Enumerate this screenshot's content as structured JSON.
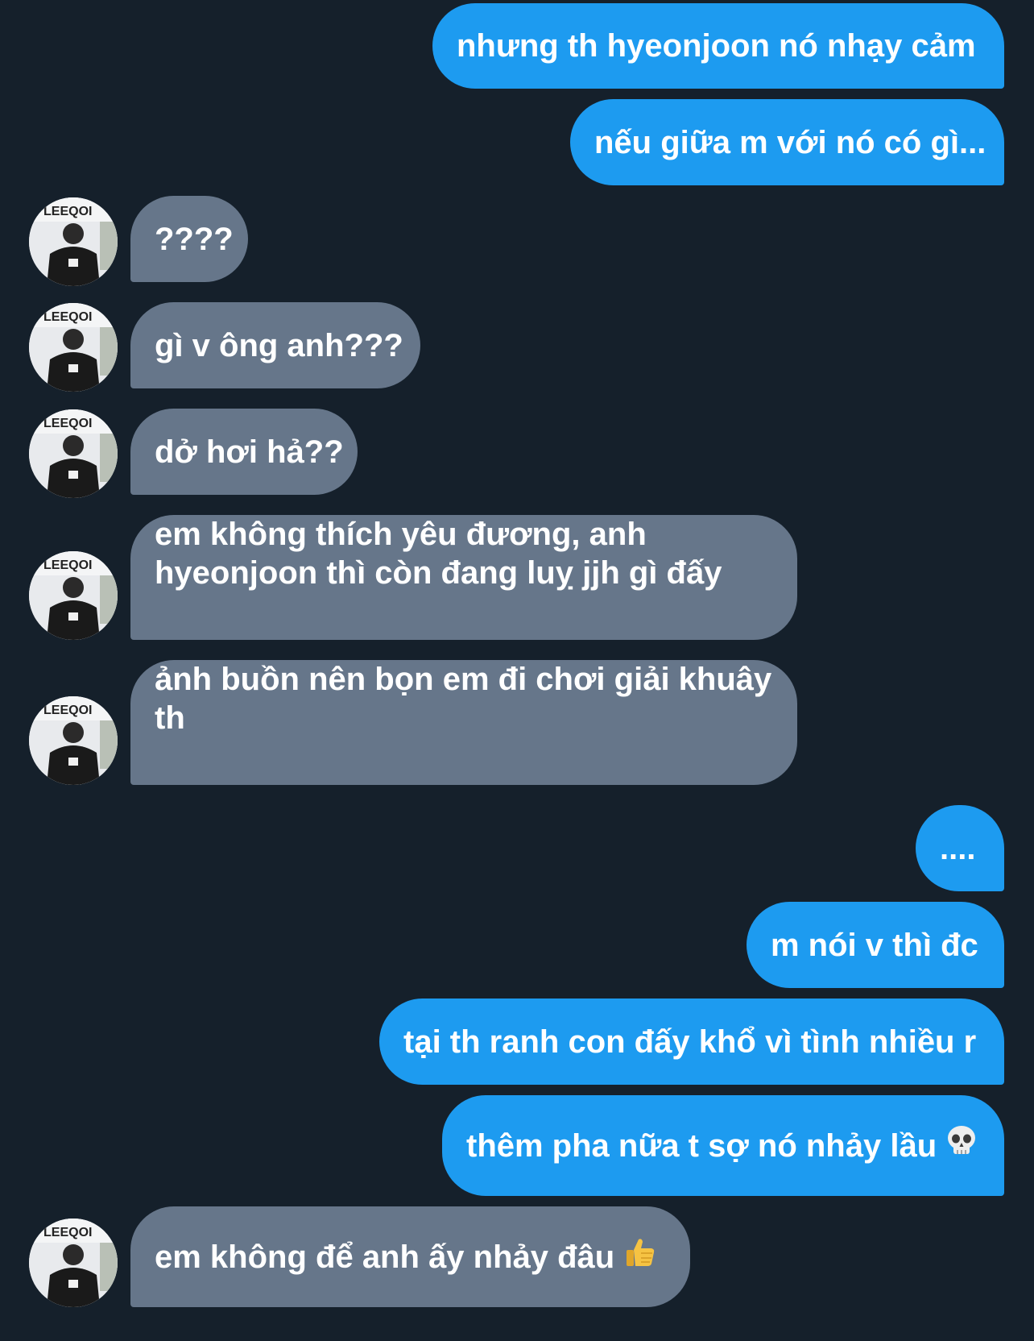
{
  "messages": [
    {
      "side": "sent",
      "text": "nhưng th hyeonjoon nó nhạy cảm"
    },
    {
      "side": "sent",
      "text": "nếu giữa m với nó có gì..."
    },
    {
      "side": "received",
      "text": "????"
    },
    {
      "side": "received",
      "text": "gì v ông anh???"
    },
    {
      "side": "received",
      "text": "dở hơi hả??"
    },
    {
      "side": "received",
      "text": "em không thích yêu đương, anh hyeonjoon thì còn đang luỵ jjh gì đấy"
    },
    {
      "side": "received",
      "text": "ảnh buồn nên bọn em đi chơi giải khuây th"
    },
    {
      "side": "sent",
      "text": "...."
    },
    {
      "side": "sent",
      "text": "m nói v thì đc"
    },
    {
      "side": "sent",
      "text": "tại th ranh con đấy khổ vì tình nhiều r"
    },
    {
      "side": "sent",
      "text": "thêm pha nữa t sợ nó nhảy lầu",
      "emoji": "skull-emoji"
    },
    {
      "side": "received",
      "text": "em không để anh ấy nhảy đâu",
      "emoji": "thumbs-up-emoji"
    }
  ],
  "colors": {
    "background": "#15202b",
    "sent_bubble": "#1d9bf0",
    "received_bubble": "#66768a",
    "text": "#ffffff"
  }
}
